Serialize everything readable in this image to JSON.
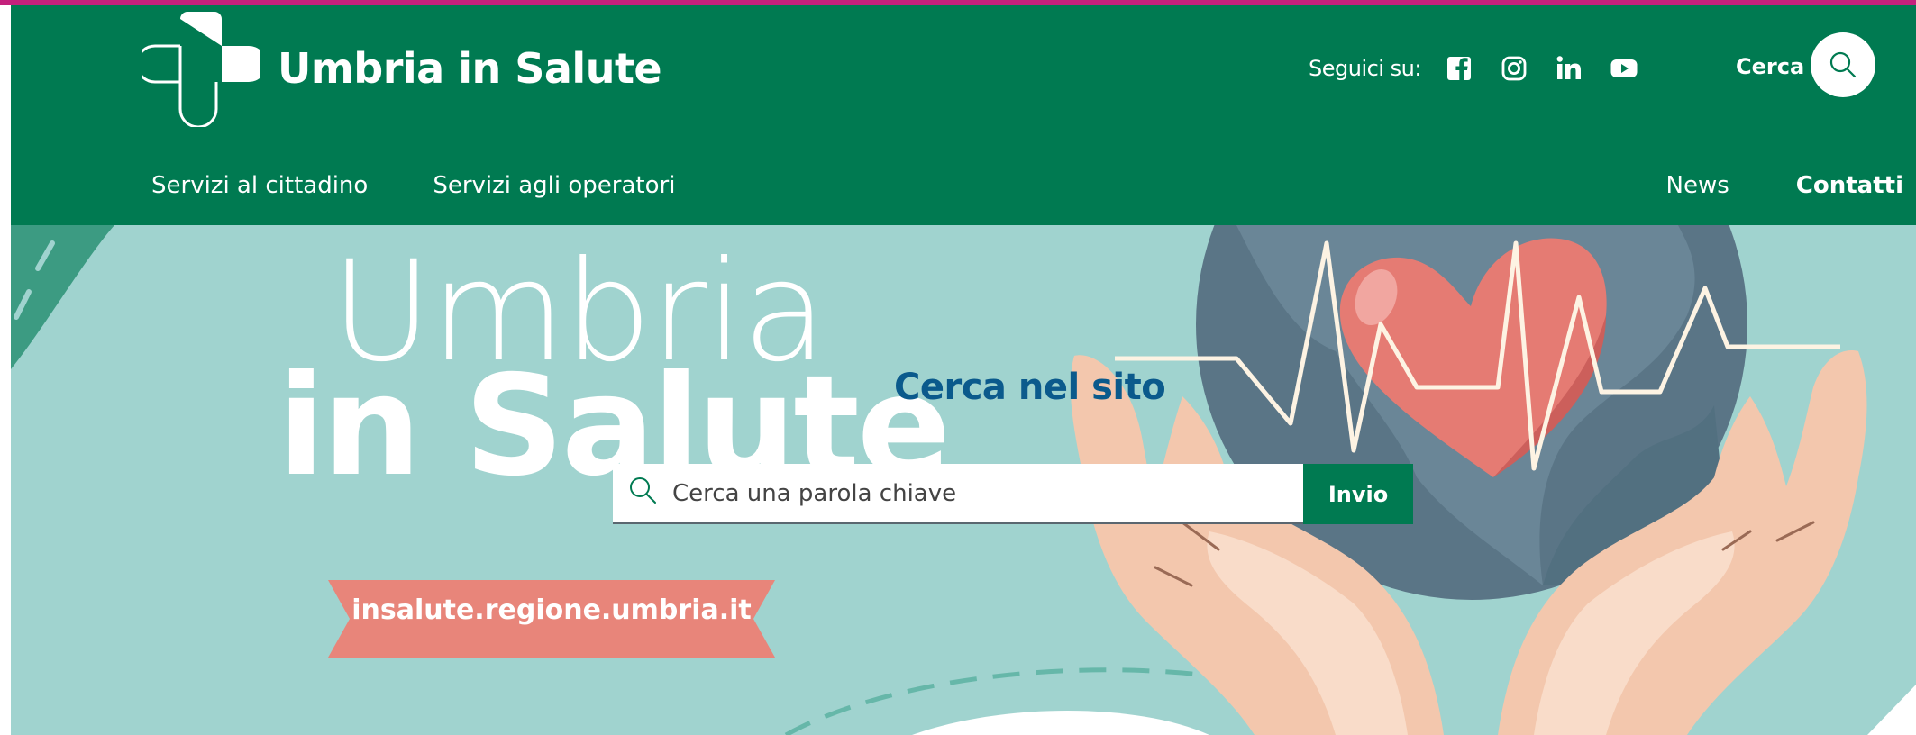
{
  "header": {
    "brand_name": "Umbria in Salute",
    "social_label": "Seguici su:",
    "social_icons": [
      "facebook-icon",
      "instagram-icon",
      "linkedin-icon",
      "youtube-icon"
    ],
    "search_label": "Cerca"
  },
  "nav": {
    "left": [
      "Servizi al cittadino",
      "Servizi agli operatori"
    ],
    "right": [
      "News",
      "Contatti"
    ]
  },
  "hero": {
    "title_line_1": "Umbria",
    "title_line_2": "in Salute",
    "url_ribbon": "insalute.regione.umbria.it",
    "search_title": "Cerca nel sito",
    "search_placeholder": "Cerca una parola chiave",
    "submit_label": "Invio"
  },
  "colors": {
    "header_green": "#007a51",
    "hero_teal": "#a0d3cf",
    "accent_pink": "#c4217c",
    "ribbon_salmon": "#e8857a",
    "search_title_blue": "#0b5a8c"
  }
}
